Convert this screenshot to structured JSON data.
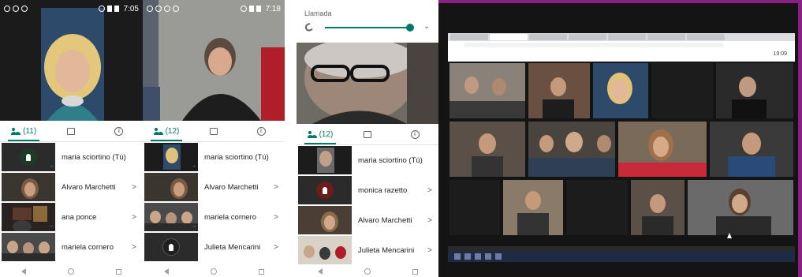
{
  "phone_a": {
    "time": "7:05",
    "participants_tab_label": "(11)",
    "participants": [
      {
        "name": "maria sciortino (Tú)",
        "chevron": "",
        "mic_color": "#2d2d2d",
        "has_mic_badge": true,
        "dots": "..."
      },
      {
        "name": "Alvaro Marchetti",
        "chevron": ">",
        "dots": ""
      },
      {
        "name": "ana ponce",
        "chevron": ">",
        "dots": "..."
      },
      {
        "name": "mariela cornero",
        "chevron": ">",
        "dots": ""
      }
    ]
  },
  "phone_b": {
    "time": "7:18",
    "participants_tab_label": "(12)",
    "participants": [
      {
        "name": "maria sciortino (Tú)",
        "chevron": "",
        "dots": "..."
      },
      {
        "name": "Alvaro Marchetti",
        "chevron": ">",
        "dots": ""
      },
      {
        "name": "mariela cornero",
        "chevron": ">",
        "dots": "..."
      },
      {
        "name": "Julieta Mencarini",
        "chevron": ">",
        "has_mic_badge": true,
        "mic_color": "#2d2d2d",
        "dots": ""
      }
    ]
  },
  "phone_c": {
    "call_title": "Llamada",
    "participants_tab_label": "(12)",
    "participants": [
      {
        "name": "maria sciortino (Tú)",
        "chevron": "",
        "dots": ""
      },
      {
        "name": "monica razetto",
        "chevron": ">",
        "has_mic_badge": true,
        "mic_color": "#6d1b1b",
        "dots": ""
      },
      {
        "name": "Alvaro Marchetti",
        "chevron": ">",
        "dots": ""
      },
      {
        "name": "Julieta Mencarini",
        "chevron": ">",
        "dots": ""
      }
    ]
  },
  "laptop": {
    "clock": "19:09"
  },
  "colors": {
    "accent": "#00796b",
    "frame_purple": "#8a1f86",
    "active_dots": "#34a853"
  },
  "icons": [
    "people-icon",
    "chat-icon",
    "info-icon",
    "mic-icon",
    "phone-icon",
    "chevron-down-icon",
    "back-icon",
    "home-icon",
    "recents-icon"
  ]
}
